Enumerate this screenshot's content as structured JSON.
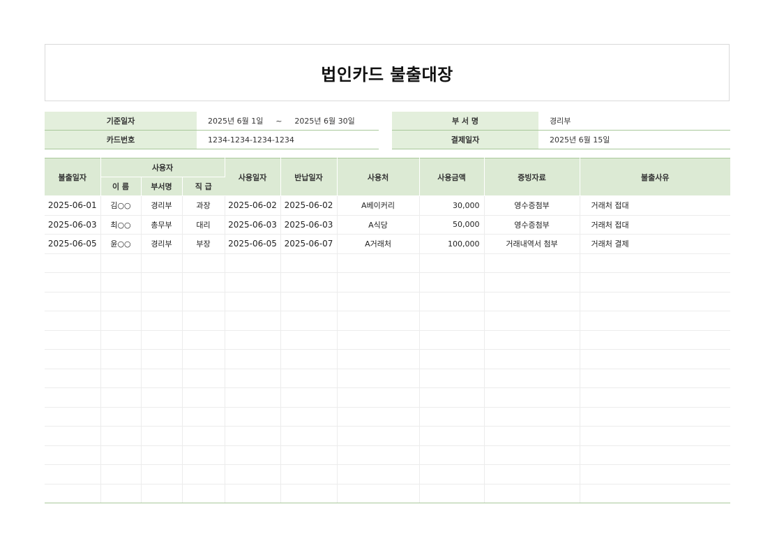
{
  "title": "법인카드 불출대장",
  "info": {
    "base_date_label": "기준일자",
    "base_date_start": "2025년 6월 1일",
    "base_date_sep": "~",
    "base_date_end": "2025년 6월 30일",
    "card_no_label": "카드번호",
    "card_no": "1234-1234-1234-1234",
    "dept_label": "부 서 명",
    "dept": "경리부",
    "pay_date_label": "결제일자",
    "pay_date": "2025년 6월 15일"
  },
  "table": {
    "headers": {
      "issue_date": "불출일자",
      "user": "사용자",
      "name": "이 름",
      "dept": "부서명",
      "rank": "직 급",
      "use_date": "사용일자",
      "return_date": "반납일자",
      "merchant": "사용처",
      "amount": "사용금액",
      "evidence": "증빙자료",
      "reason": "불출사유"
    },
    "rows": [
      {
        "issue_date": "2025-06-01",
        "name": "김○○",
        "dept": "경리부",
        "rank": "과장",
        "use_date": "2025-06-02",
        "return_date": "2025-06-02",
        "merchant": "A베이커리",
        "amount": "30,000",
        "evidence": "영수증첨부",
        "reason": "거래처 접대"
      },
      {
        "issue_date": "2025-06-03",
        "name": "최○○",
        "dept": "총무부",
        "rank": "대리",
        "use_date": "2025-06-03",
        "return_date": "2025-06-03",
        "merchant": "A식당",
        "amount": "50,000",
        "evidence": "영수증첨부",
        "reason": "거래처 접대"
      },
      {
        "issue_date": "2025-06-05",
        "name": "윤○○",
        "dept": "경리부",
        "rank": "부장",
        "use_date": "2025-06-05",
        "return_date": "2025-06-07",
        "merchant": "A거래처",
        "amount": "100,000",
        "evidence": "거래내역서 첨부",
        "reason": "거래처 결제"
      }
    ]
  }
}
